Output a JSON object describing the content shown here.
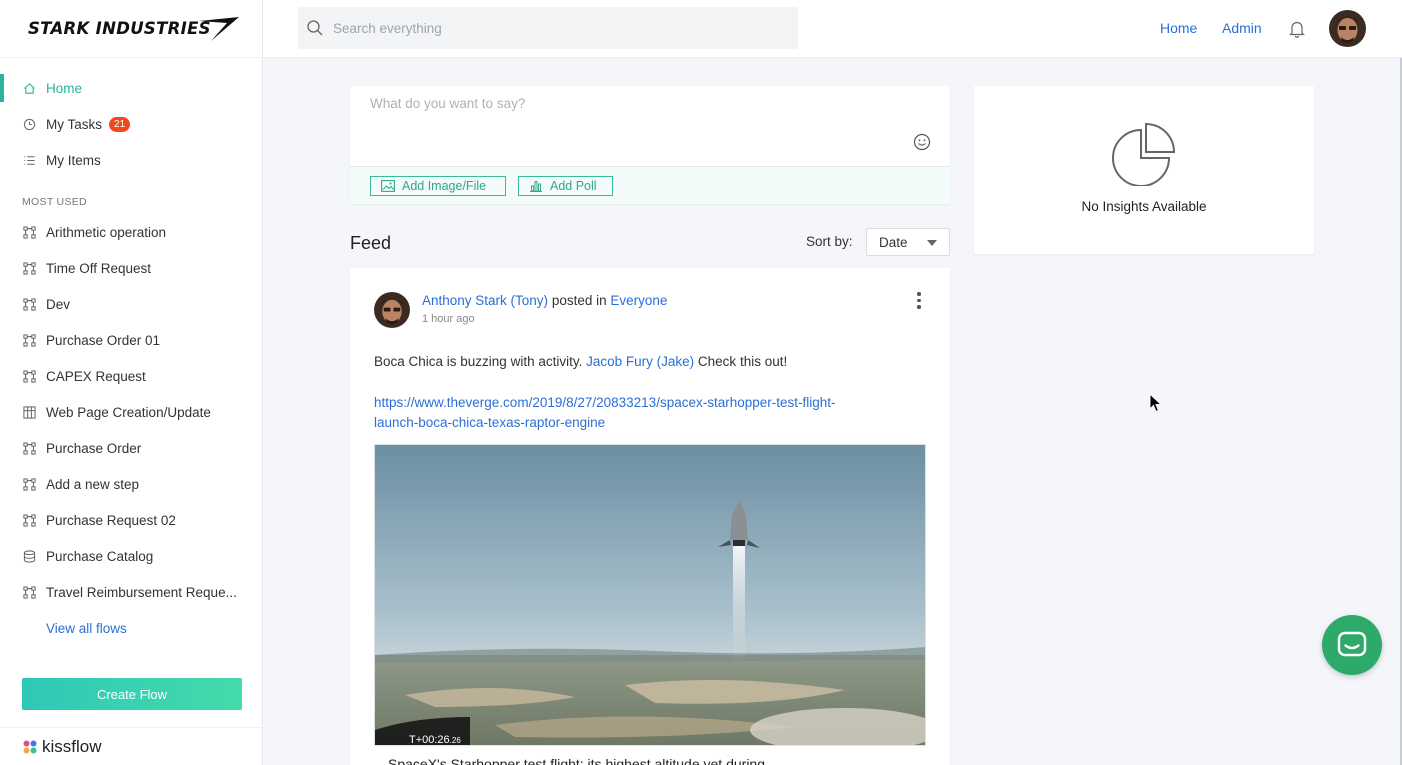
{
  "brand": {
    "logo_text": "STARK INDUSTRIES",
    "footer_name": "kissflow"
  },
  "search": {
    "placeholder": "Search everything"
  },
  "topnav": {
    "home": "Home",
    "admin": "Admin"
  },
  "sidebar": {
    "primary": [
      {
        "label": "Home",
        "icon": "home-icon",
        "active": true
      },
      {
        "label": "My Tasks",
        "icon": "clock-icon",
        "badge": "21"
      },
      {
        "label": "My Items",
        "icon": "list-icon"
      }
    ],
    "section_label": "MOST USED",
    "flows": [
      {
        "label": "Arithmetic operation",
        "icon": "flow-icon"
      },
      {
        "label": "Time Off Request",
        "icon": "flow-icon"
      },
      {
        "label": "Dev",
        "icon": "flow-icon"
      },
      {
        "label": "Purchase Order 01",
        "icon": "flow-icon"
      },
      {
        "label": "CAPEX Request",
        "icon": "flow-icon"
      },
      {
        "label": "Web Page Creation/Update",
        "icon": "board-icon"
      },
      {
        "label": "Purchase Order",
        "icon": "flow-icon"
      },
      {
        "label": "Add a new step",
        "icon": "flow-icon"
      },
      {
        "label": "Purchase Request 02",
        "icon": "flow-icon"
      },
      {
        "label": "Purchase Catalog",
        "icon": "database-icon"
      },
      {
        "label": "Travel Reimbursement Reque...",
        "icon": "flow-icon"
      }
    ],
    "view_all": "View all flows",
    "create_button": "Create Flow"
  },
  "composer": {
    "placeholder": "What do you want to say?",
    "add_image": "Add Image/File",
    "add_poll": "Add Poll"
  },
  "feed": {
    "title": "Feed",
    "sort_label": "Sort by:",
    "sort_value": "Date"
  },
  "post": {
    "author": "Anthony Stark (Tony)",
    "posted_in_text": "posted in",
    "channel": "Everyone",
    "time": "1 hour ago",
    "body_before": "Boca Chica is buzzing with activity.",
    "mention": "Jacob Fury (Jake)",
    "body_after": "Check this out!",
    "url_line1": "https://www.theverge.com/2019/8/27/20833213/spacex-starhopper-test-flight-",
    "url_line2": "launch-boca-chica-texas-raptor-engine",
    "video_time": "T+00:26",
    "video_time_frac": ".26",
    "preview_title": "SpaceX's Starhopper test flight: its highest altitude yet during"
  },
  "insights": {
    "text": "No Insights Available"
  },
  "colors": {
    "accent": "#2bb49b",
    "link": "#2b6fd6",
    "badge": "#f04a1b",
    "chat": "#2daa6a"
  }
}
